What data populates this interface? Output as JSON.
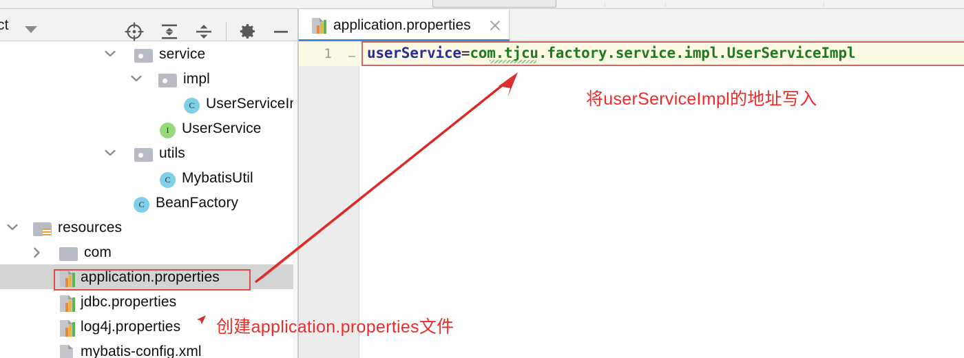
{
  "window": {
    "left_panel": {
      "toolbar": {
        "project_label": "ct",
        "dropdown_icon": "chevron-down-icon",
        "buttons": [
          {
            "name": "locate-in-tree",
            "icon": "crosshair-target-icon"
          },
          {
            "name": "expand-all",
            "icon": "expand-all-icon"
          },
          {
            "name": "collapse-all",
            "icon": "collapse-all-icon"
          },
          {
            "name": "settings",
            "icon": "gear-icon"
          },
          {
            "name": "hide-panel",
            "icon": "minimize-icon"
          }
        ]
      },
      "tree": [
        {
          "label": "service",
          "type": "folder",
          "indent": 3,
          "expanded": true,
          "selected": false
        },
        {
          "label": "impl",
          "type": "folder",
          "indent": 4,
          "expanded": true,
          "selected": false
        },
        {
          "label": "UserServiceIm",
          "type": "class",
          "badge": "C",
          "indent": 6,
          "selected": false
        },
        {
          "label": "UserService",
          "type": "interface",
          "badge": "I",
          "indent": 5,
          "selected": false
        },
        {
          "label": "utils",
          "type": "folder",
          "indent": 3,
          "expanded": true,
          "selected": false
        },
        {
          "label": "MybatisUtil",
          "type": "class",
          "badge": "C",
          "indent": 5,
          "selected": false
        },
        {
          "label": "BeanFactory",
          "type": "class",
          "badge": "C",
          "indent": 4,
          "selected": false
        },
        {
          "label": "resources",
          "type": "resource-folder",
          "indent": 1,
          "expanded": true,
          "selected": false
        },
        {
          "label": "com",
          "type": "folder",
          "indent": 2,
          "expanded": false,
          "selected": false
        },
        {
          "label": "application.properties",
          "type": "properties-file",
          "indent": 2,
          "selected": true
        },
        {
          "label": "jdbc.properties",
          "type": "properties-file",
          "indent": 2,
          "selected": false
        },
        {
          "label": "log4j.properties",
          "type": "properties-file",
          "indent": 2,
          "selected": false
        },
        {
          "label": "mybatis-config.xml",
          "type": "xml-file",
          "indent": 2,
          "selected": false
        }
      ]
    },
    "editor": {
      "tab": {
        "title": "application.properties",
        "icon": "properties-file-icon",
        "close_icon": "close-icon",
        "active": true
      },
      "line_number": "1",
      "code": {
        "key": "userService",
        "equals": "=",
        "value": "com.tjcu.factory.service.impl.UserServiceImpl",
        "full": "userService=com.tjcu.factory.service.impl.UserServiceImpl"
      }
    },
    "annotations": [
      {
        "name": "annotation-editor",
        "text": "将userServiceImpl的地址写入"
      },
      {
        "name": "annotation-tree",
        "text": "创建application.properties文件"
      }
    ]
  },
  "colors": {
    "accent_tab": "#3b8ad8",
    "annotation_red": "#ee2b28",
    "code_key": "#2b2b9c",
    "code_value": "#1f7a1f",
    "current_line": "#fbf8e4",
    "selection": "#d4d4d4",
    "class_badge": "#7fcfe8",
    "interface_badge": "#97d97d"
  }
}
